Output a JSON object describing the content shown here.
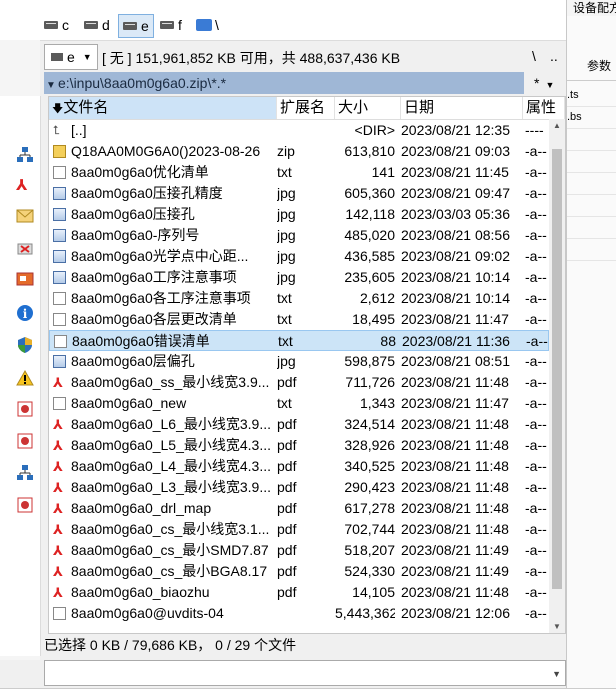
{
  "drives": [
    {
      "letter": "c",
      "selected": false
    },
    {
      "letter": "d",
      "selected": false
    },
    {
      "letter": "e",
      "selected": true
    },
    {
      "letter": "f",
      "selected": false
    },
    {
      "letter": "\\",
      "selected": false
    }
  ],
  "right_panel": {
    "top_label": "设备配方",
    "tab_label": "参数",
    "lines": [
      ".ts",
      ".bs"
    ]
  },
  "free_space": {
    "drive": "e",
    "text": "[ 无 ]  151,961,852 KB 可用，共 488,637,436 KB"
  },
  "top_right_buttons": [
    "\\",
    ".."
  ],
  "path": {
    "text": "e:\\inpu\\8aa0m0g6a0.zip\\*.*",
    "filter": "*"
  },
  "columns": {
    "name": "文件名",
    "ext": "扩展名",
    "size": "大小",
    "date": "日期",
    "attr": "属性"
  },
  "files": [
    {
      "icon": "up",
      "name": "[..]",
      "ext": "",
      "size": "<DIR>",
      "date": "2023/08/21 12:35",
      "attr": "----"
    },
    {
      "icon": "zip",
      "name": "Q18AA0M0G6A0()2023-08-26",
      "ext": "zip",
      "size": "613,810",
      "date": "2023/08/21 09:03",
      "attr": "-a--"
    },
    {
      "icon": "txt",
      "name": "8aa0m0g6a0优化清单",
      "ext": "txt",
      "size": "141",
      "date": "2023/08/21 11:45",
      "attr": "-a--"
    },
    {
      "icon": "img",
      "name": "8aa0m0g6a0压接孔精度",
      "ext": "jpg",
      "size": "605,360",
      "date": "2023/08/21 09:47",
      "attr": "-a--"
    },
    {
      "icon": "img",
      "name": "8aa0m0g6a0压接孔",
      "ext": "jpg",
      "size": "142,118",
      "date": "2023/03/03 05:36",
      "attr": "-a--"
    },
    {
      "icon": "img",
      "name": "8aa0m0g6a0-序列号",
      "ext": "jpg",
      "size": "485,020",
      "date": "2023/08/21 08:56",
      "attr": "-a--"
    },
    {
      "icon": "img",
      "name": "8aa0m0g6a0光学点中心距...",
      "ext": "jpg",
      "size": "436,585",
      "date": "2023/08/21 09:02",
      "attr": "-a--"
    },
    {
      "icon": "img",
      "name": "8aa0m0g6a0工序注意事项",
      "ext": "jpg",
      "size": "235,605",
      "date": "2023/08/21 10:14",
      "attr": "-a--"
    },
    {
      "icon": "txt",
      "name": "8aa0m0g6a0各工序注意事项",
      "ext": "txt",
      "size": "2,612",
      "date": "2023/08/21 10:14",
      "attr": "-a--"
    },
    {
      "icon": "txt",
      "name": "8aa0m0g6a0各层更改清单",
      "ext": "txt",
      "size": "18,495",
      "date": "2023/08/21 11:47",
      "attr": "-a--"
    },
    {
      "icon": "txt",
      "name": "8aa0m0g6a0错误清单",
      "ext": "txt",
      "size": "88",
      "date": "2023/08/21 11:36",
      "attr": "-a--",
      "selected": true
    },
    {
      "icon": "img",
      "name": "8aa0m0g6a0层偏孔",
      "ext": "jpg",
      "size": "598,875",
      "date": "2023/08/21 08:51",
      "attr": "-a--"
    },
    {
      "icon": "pdf",
      "name": "8aa0m0g6a0_ss_最小线宽3.9...",
      "ext": "pdf",
      "size": "711,726",
      "date": "2023/08/21 11:48",
      "attr": "-a--"
    },
    {
      "icon": "txt",
      "name": "8aa0m0g6a0_new",
      "ext": "txt",
      "size": "1,343",
      "date": "2023/08/21 11:47",
      "attr": "-a--"
    },
    {
      "icon": "pdf",
      "name": "8aa0m0g6a0_L6_最小线宽3.9...",
      "ext": "pdf",
      "size": "324,514",
      "date": "2023/08/21 11:48",
      "attr": "-a--"
    },
    {
      "icon": "pdf",
      "name": "8aa0m0g6a0_L5_最小线宽4.3...",
      "ext": "pdf",
      "size": "328,926",
      "date": "2023/08/21 11:48",
      "attr": "-a--"
    },
    {
      "icon": "pdf",
      "name": "8aa0m0g6a0_L4_最小线宽4.3...",
      "ext": "pdf",
      "size": "340,525",
      "date": "2023/08/21 11:48",
      "attr": "-a--"
    },
    {
      "icon": "pdf",
      "name": "8aa0m0g6a0_L3_最小线宽3.9...",
      "ext": "pdf",
      "size": "290,423",
      "date": "2023/08/21 11:48",
      "attr": "-a--"
    },
    {
      "icon": "pdf",
      "name": "8aa0m0g6a0_drl_map",
      "ext": "pdf",
      "size": "617,278",
      "date": "2023/08/21 11:48",
      "attr": "-a--"
    },
    {
      "icon": "pdf",
      "name": "8aa0m0g6a0_cs_最小线宽3.1...",
      "ext": "pdf",
      "size": "702,744",
      "date": "2023/08/21 11:48",
      "attr": "-a--"
    },
    {
      "icon": "pdf",
      "name": "8aa0m0g6a0_cs_最小SMD7.87",
      "ext": "pdf",
      "size": "518,207",
      "date": "2023/08/21 11:49",
      "attr": "-a--"
    },
    {
      "icon": "pdf",
      "name": "8aa0m0g6a0_cs_最小BGA8.17",
      "ext": "pdf",
      "size": "524,330",
      "date": "2023/08/21 11:49",
      "attr": "-a--"
    },
    {
      "icon": "pdf",
      "name": "8aa0m0g6a0_biaozhu",
      "ext": "pdf",
      "size": "14,105",
      "date": "2023/08/21 11:48",
      "attr": "-a--"
    },
    {
      "icon": "txt",
      "name": "8aa0m0g6a0@uvdits-04",
      "ext": "",
      "size": "5,443,362",
      "date": "2023/08/21 12:06",
      "attr": "-a--"
    }
  ],
  "status": "已选择 0 KB / 79,686 KB， 0 / 29 个文件",
  "colors": {
    "path_bar": "#9fb7d6",
    "selection": "#cce4f7",
    "header_highlight": "#cde3f7",
    "pdf_red": "#dd2222"
  }
}
